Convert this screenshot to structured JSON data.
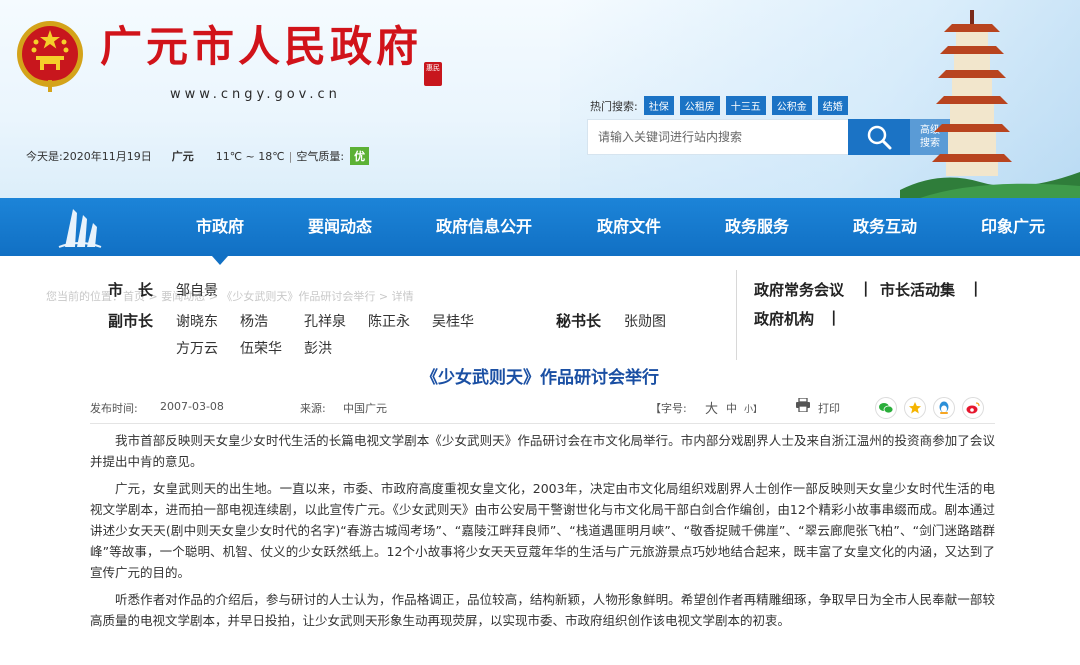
{
  "header": {
    "title": "广元市人民政府",
    "url": "www.cngy.gov.cn",
    "seal_text": "惠民",
    "date_label": "今天是:2020年11月19日",
    "city": "广元",
    "temperature": "11℃ ~ 18℃",
    "air_quality_label": "空气质量:",
    "air_quality_value": "优",
    "hot_search_label": "热门搜索:",
    "hot_tags": [
      "社保",
      "公租房",
      "十三五",
      "公积金",
      "结婚"
    ],
    "search_placeholder": "请输入关键词进行站内搜索",
    "advanced_search_line1": "高级",
    "advanced_search_line2": "搜索"
  },
  "nav": {
    "items": [
      "市政府",
      "要闻动态",
      "政府信息公开",
      "政府文件",
      "政务服务",
      "政务互动",
      "印象广元"
    ]
  },
  "breadcrumb": "您当前的位置：首页 > 要闻动态 > 《少女武则天》作品研讨会举行 > 详情",
  "leaders": {
    "mayor_label": "市　长",
    "mayor": "邹自景",
    "vice_label": "副市长",
    "vice_mayors": [
      "谢晓东",
      "杨浩",
      "孔祥泉",
      "陈正永",
      "吴桂华",
      "方万云",
      "伍荣华",
      "彭洪"
    ],
    "secretary_label": "秘书长",
    "secretary": "张勋图",
    "links": [
      "政府常务会议",
      "市长活动集",
      "政府机构"
    ],
    "link_sep": "|"
  },
  "article": {
    "title": "《少女武则天》作品研讨会举行",
    "publish_label": "发布时间:",
    "publish_date": "2007-03-08",
    "source_label": "来源:",
    "source": "中国广元",
    "font_label": "【字号:",
    "font_big": "大",
    "font_mid": "中",
    "font_small": "小】",
    "print_label": "打印",
    "paragraphs": [
      "我市首部反映则天女皇少女时代生活的长篇电视文学剧本《少女武则天》作品研讨会在市文化局举行。市内部分戏剧界人士及来自浙江温州的投资商参加了会议并提出中肯的意见。",
      "广元，女皇武则天的出生地。一直以来，市委、市政府高度重视女皇文化，2003年，决定由市文化局组织戏剧界人士创作一部反映则天女皇少女时代生活的电视文学剧本，进而拍一部电视连续剧，以此宣传广元。《少女武则天》由市公安局干警谢世化与市文化局干部白剑合作编创，由12个精彩小故事串缀而成。剧本通过讲述少女天天(剧中则天女皇少女时代的名字)“春游古城闯考场”、“嘉陵江畔拜良师”、“栈道遇匪明月峡”、“敬香捉贼千佛崖”、“翠云廊爬张飞柏”、“剑门迷路踏群峰”等故事，一个聪明、机智、仗义的少女跃然纸上。12个小故事将少女天天豆蔻年华的生活与广元旅游景点巧妙地结合起来，既丰富了女皇文化的内涵，又达到了宣传广元的目的。",
      "听悉作者对作品的介绍后，参与研讨的人士认为，作品格调正，品位较高，结构新颖，人物形象鲜明。希望创作者再精雕细琢，争取早日为全市人民奉献一部较高质量的电视文学剧本，并早日投拍，让少女武则天形象生动再现荧屏，以实现市委、市政府组织创作该电视文学剧本的初衷。"
    ]
  },
  "colors": {
    "brand_red": "#d1131a",
    "nav_blue": "#1170c4",
    "title_blue": "#1a4fa3",
    "aq_green": "#5cb135"
  }
}
